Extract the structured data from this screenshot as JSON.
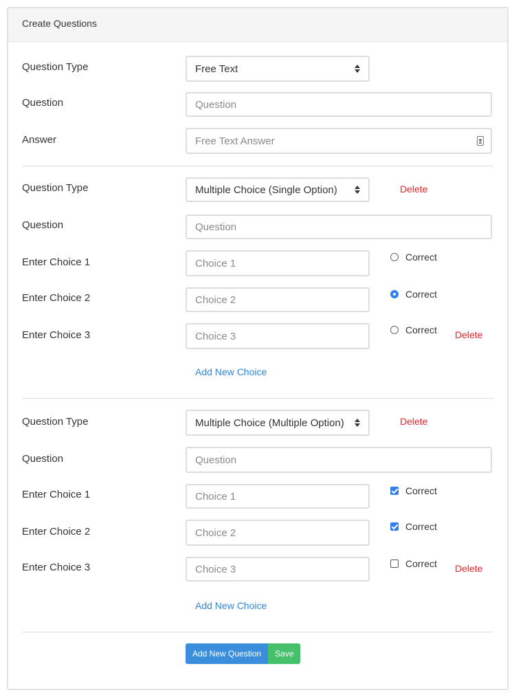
{
  "header": {
    "title": "Create Questions"
  },
  "questions": [
    {
      "type_label": "Question Type",
      "type_value": "Free Text",
      "question_label": "Question",
      "question_placeholder": "Question",
      "answer_label": "Answer",
      "answer_placeholder": "Free Text Answer"
    },
    {
      "type_label": "Question Type",
      "type_value": "Multiple Choice (Single Option)",
      "delete_label": "Delete",
      "question_label": "Question",
      "question_placeholder": "Question",
      "choices": [
        {
          "label": "Enter Choice 1",
          "placeholder": "Choice 1",
          "correct_label": "Correct",
          "checked": false
        },
        {
          "label": "Enter Choice 2",
          "placeholder": "Choice 2",
          "correct_label": "Correct",
          "checked": true
        },
        {
          "label": "Enter Choice 3",
          "placeholder": "Choice 3",
          "correct_label": "Correct",
          "checked": false,
          "delete_label": "Delete"
        }
      ],
      "add_choice_label": "Add New Choice"
    },
    {
      "type_label": "Question Type",
      "type_value": "Multiple Choice (Multiple Option)",
      "delete_label": "Delete",
      "question_label": "Question",
      "question_placeholder": "Question",
      "choices": [
        {
          "label": "Enter Choice 1",
          "placeholder": "Choice 1",
          "correct_label": "Correct",
          "checked": true
        },
        {
          "label": "Enter Choice 2",
          "placeholder": "Choice 2",
          "correct_label": "Correct",
          "checked": true
        },
        {
          "label": "Enter Choice 3",
          "placeholder": "Choice 3",
          "correct_label": "Correct",
          "checked": false,
          "delete_label": "Delete"
        }
      ],
      "add_choice_label": "Add New Choice"
    }
  ],
  "footer": {
    "add_question_label": "Add New Question",
    "save_label": "Save"
  },
  "colors": {
    "delete": "#e0252b",
    "link": "#2f86d9",
    "primary": "#3a8edb",
    "success": "#46c06a"
  }
}
